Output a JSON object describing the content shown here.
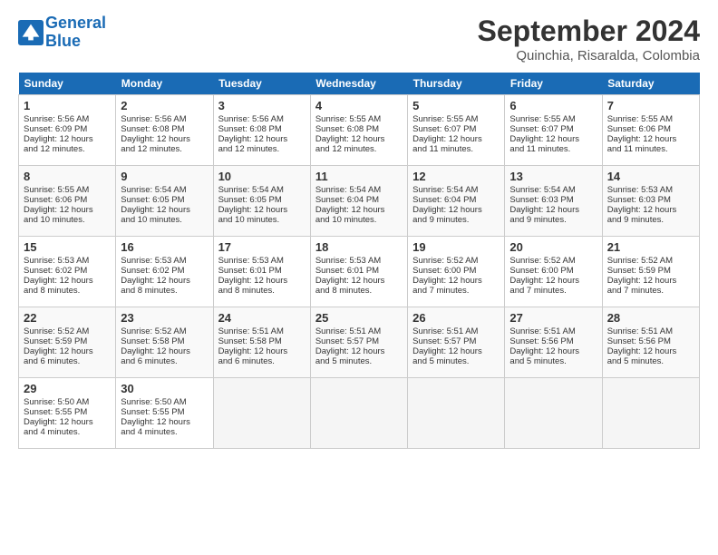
{
  "logo": {
    "line1": "General",
    "line2": "Blue"
  },
  "title": "September 2024",
  "subtitle": "Quinchia, Risaralda, Colombia",
  "columns": [
    "Sunday",
    "Monday",
    "Tuesday",
    "Wednesday",
    "Thursday",
    "Friday",
    "Saturday"
  ],
  "weeks": [
    [
      {
        "day": "1",
        "lines": [
          "Sunrise: 5:56 AM",
          "Sunset: 6:09 PM",
          "Daylight: 12 hours",
          "and 12 minutes."
        ]
      },
      {
        "day": "2",
        "lines": [
          "Sunrise: 5:56 AM",
          "Sunset: 6:08 PM",
          "Daylight: 12 hours",
          "and 12 minutes."
        ]
      },
      {
        "day": "3",
        "lines": [
          "Sunrise: 5:56 AM",
          "Sunset: 6:08 PM",
          "Daylight: 12 hours",
          "and 12 minutes."
        ]
      },
      {
        "day": "4",
        "lines": [
          "Sunrise: 5:55 AM",
          "Sunset: 6:08 PM",
          "Daylight: 12 hours",
          "and 12 minutes."
        ]
      },
      {
        "day": "5",
        "lines": [
          "Sunrise: 5:55 AM",
          "Sunset: 6:07 PM",
          "Daylight: 12 hours",
          "and 11 minutes."
        ]
      },
      {
        "day": "6",
        "lines": [
          "Sunrise: 5:55 AM",
          "Sunset: 6:07 PM",
          "Daylight: 12 hours",
          "and 11 minutes."
        ]
      },
      {
        "day": "7",
        "lines": [
          "Sunrise: 5:55 AM",
          "Sunset: 6:06 PM",
          "Daylight: 12 hours",
          "and 11 minutes."
        ]
      }
    ],
    [
      {
        "day": "8",
        "lines": [
          "Sunrise: 5:55 AM",
          "Sunset: 6:06 PM",
          "Daylight: 12 hours",
          "and 10 minutes."
        ]
      },
      {
        "day": "9",
        "lines": [
          "Sunrise: 5:54 AM",
          "Sunset: 6:05 PM",
          "Daylight: 12 hours",
          "and 10 minutes."
        ]
      },
      {
        "day": "10",
        "lines": [
          "Sunrise: 5:54 AM",
          "Sunset: 6:05 PM",
          "Daylight: 12 hours",
          "and 10 minutes."
        ]
      },
      {
        "day": "11",
        "lines": [
          "Sunrise: 5:54 AM",
          "Sunset: 6:04 PM",
          "Daylight: 12 hours",
          "and 10 minutes."
        ]
      },
      {
        "day": "12",
        "lines": [
          "Sunrise: 5:54 AM",
          "Sunset: 6:04 PM",
          "Daylight: 12 hours",
          "and 9 minutes."
        ]
      },
      {
        "day": "13",
        "lines": [
          "Sunrise: 5:54 AM",
          "Sunset: 6:03 PM",
          "Daylight: 12 hours",
          "and 9 minutes."
        ]
      },
      {
        "day": "14",
        "lines": [
          "Sunrise: 5:53 AM",
          "Sunset: 6:03 PM",
          "Daylight: 12 hours",
          "and 9 minutes."
        ]
      }
    ],
    [
      {
        "day": "15",
        "lines": [
          "Sunrise: 5:53 AM",
          "Sunset: 6:02 PM",
          "Daylight: 12 hours",
          "and 8 minutes."
        ]
      },
      {
        "day": "16",
        "lines": [
          "Sunrise: 5:53 AM",
          "Sunset: 6:02 PM",
          "Daylight: 12 hours",
          "and 8 minutes."
        ]
      },
      {
        "day": "17",
        "lines": [
          "Sunrise: 5:53 AM",
          "Sunset: 6:01 PM",
          "Daylight: 12 hours",
          "and 8 minutes."
        ]
      },
      {
        "day": "18",
        "lines": [
          "Sunrise: 5:53 AM",
          "Sunset: 6:01 PM",
          "Daylight: 12 hours",
          "and 8 minutes."
        ]
      },
      {
        "day": "19",
        "lines": [
          "Sunrise: 5:52 AM",
          "Sunset: 6:00 PM",
          "Daylight: 12 hours",
          "and 7 minutes."
        ]
      },
      {
        "day": "20",
        "lines": [
          "Sunrise: 5:52 AM",
          "Sunset: 6:00 PM",
          "Daylight: 12 hours",
          "and 7 minutes."
        ]
      },
      {
        "day": "21",
        "lines": [
          "Sunrise: 5:52 AM",
          "Sunset: 5:59 PM",
          "Daylight: 12 hours",
          "and 7 minutes."
        ]
      }
    ],
    [
      {
        "day": "22",
        "lines": [
          "Sunrise: 5:52 AM",
          "Sunset: 5:59 PM",
          "Daylight: 12 hours",
          "and 6 minutes."
        ]
      },
      {
        "day": "23",
        "lines": [
          "Sunrise: 5:52 AM",
          "Sunset: 5:58 PM",
          "Daylight: 12 hours",
          "and 6 minutes."
        ]
      },
      {
        "day": "24",
        "lines": [
          "Sunrise: 5:51 AM",
          "Sunset: 5:58 PM",
          "Daylight: 12 hours",
          "and 6 minutes."
        ]
      },
      {
        "day": "25",
        "lines": [
          "Sunrise: 5:51 AM",
          "Sunset: 5:57 PM",
          "Daylight: 12 hours",
          "and 5 minutes."
        ]
      },
      {
        "day": "26",
        "lines": [
          "Sunrise: 5:51 AM",
          "Sunset: 5:57 PM",
          "Daylight: 12 hours",
          "and 5 minutes."
        ]
      },
      {
        "day": "27",
        "lines": [
          "Sunrise: 5:51 AM",
          "Sunset: 5:56 PM",
          "Daylight: 12 hours",
          "and 5 minutes."
        ]
      },
      {
        "day": "28",
        "lines": [
          "Sunrise: 5:51 AM",
          "Sunset: 5:56 PM",
          "Daylight: 12 hours",
          "and 5 minutes."
        ]
      }
    ],
    [
      {
        "day": "29",
        "lines": [
          "Sunrise: 5:50 AM",
          "Sunset: 5:55 PM",
          "Daylight: 12 hours",
          "and 4 minutes."
        ]
      },
      {
        "day": "30",
        "lines": [
          "Sunrise: 5:50 AM",
          "Sunset: 5:55 PM",
          "Daylight: 12 hours",
          "and 4 minutes."
        ]
      },
      null,
      null,
      null,
      null,
      null
    ]
  ]
}
